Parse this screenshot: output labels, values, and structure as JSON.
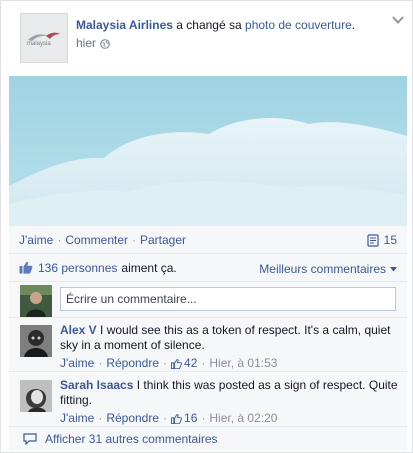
{
  "post": {
    "author": "Malaysia Airlines",
    "action_text": "a changé sa",
    "action_link": "photo de couverture",
    "action_end": ".",
    "time": "hier",
    "logo_text": "malaysia"
  },
  "actions": {
    "like": "J'aime",
    "comment": "Commenter",
    "share": "Partager",
    "separator": "·",
    "comment_count": "15"
  },
  "likes": {
    "count_link": "136 personnes",
    "suffix": "aiment ça.",
    "best_comments": "Meilleurs commentaires"
  },
  "write_comment": {
    "placeholder": "Écrire un commentaire..."
  },
  "comments": [
    {
      "author": "Alex V",
      "text": "I would see this as a token of respect. It's a calm, quiet sky in a moment of silence.",
      "like": "J'aime",
      "reply": "Répondre",
      "likes": "42",
      "time": "Hier, à 01:53"
    },
    {
      "author": "Sarah Isaacs",
      "text": "I think this was posted as a sign of respect. Quite fitting.",
      "like": "J'aime",
      "reply": "Répondre",
      "likes": "16",
      "time": "Hier, à 02:20"
    }
  ],
  "more_comments": "Afficher 31 autres commentaires",
  "colors": {
    "link": "#3b5998",
    "panel": "#f6f7f9",
    "sky": "#a7d7e5"
  }
}
